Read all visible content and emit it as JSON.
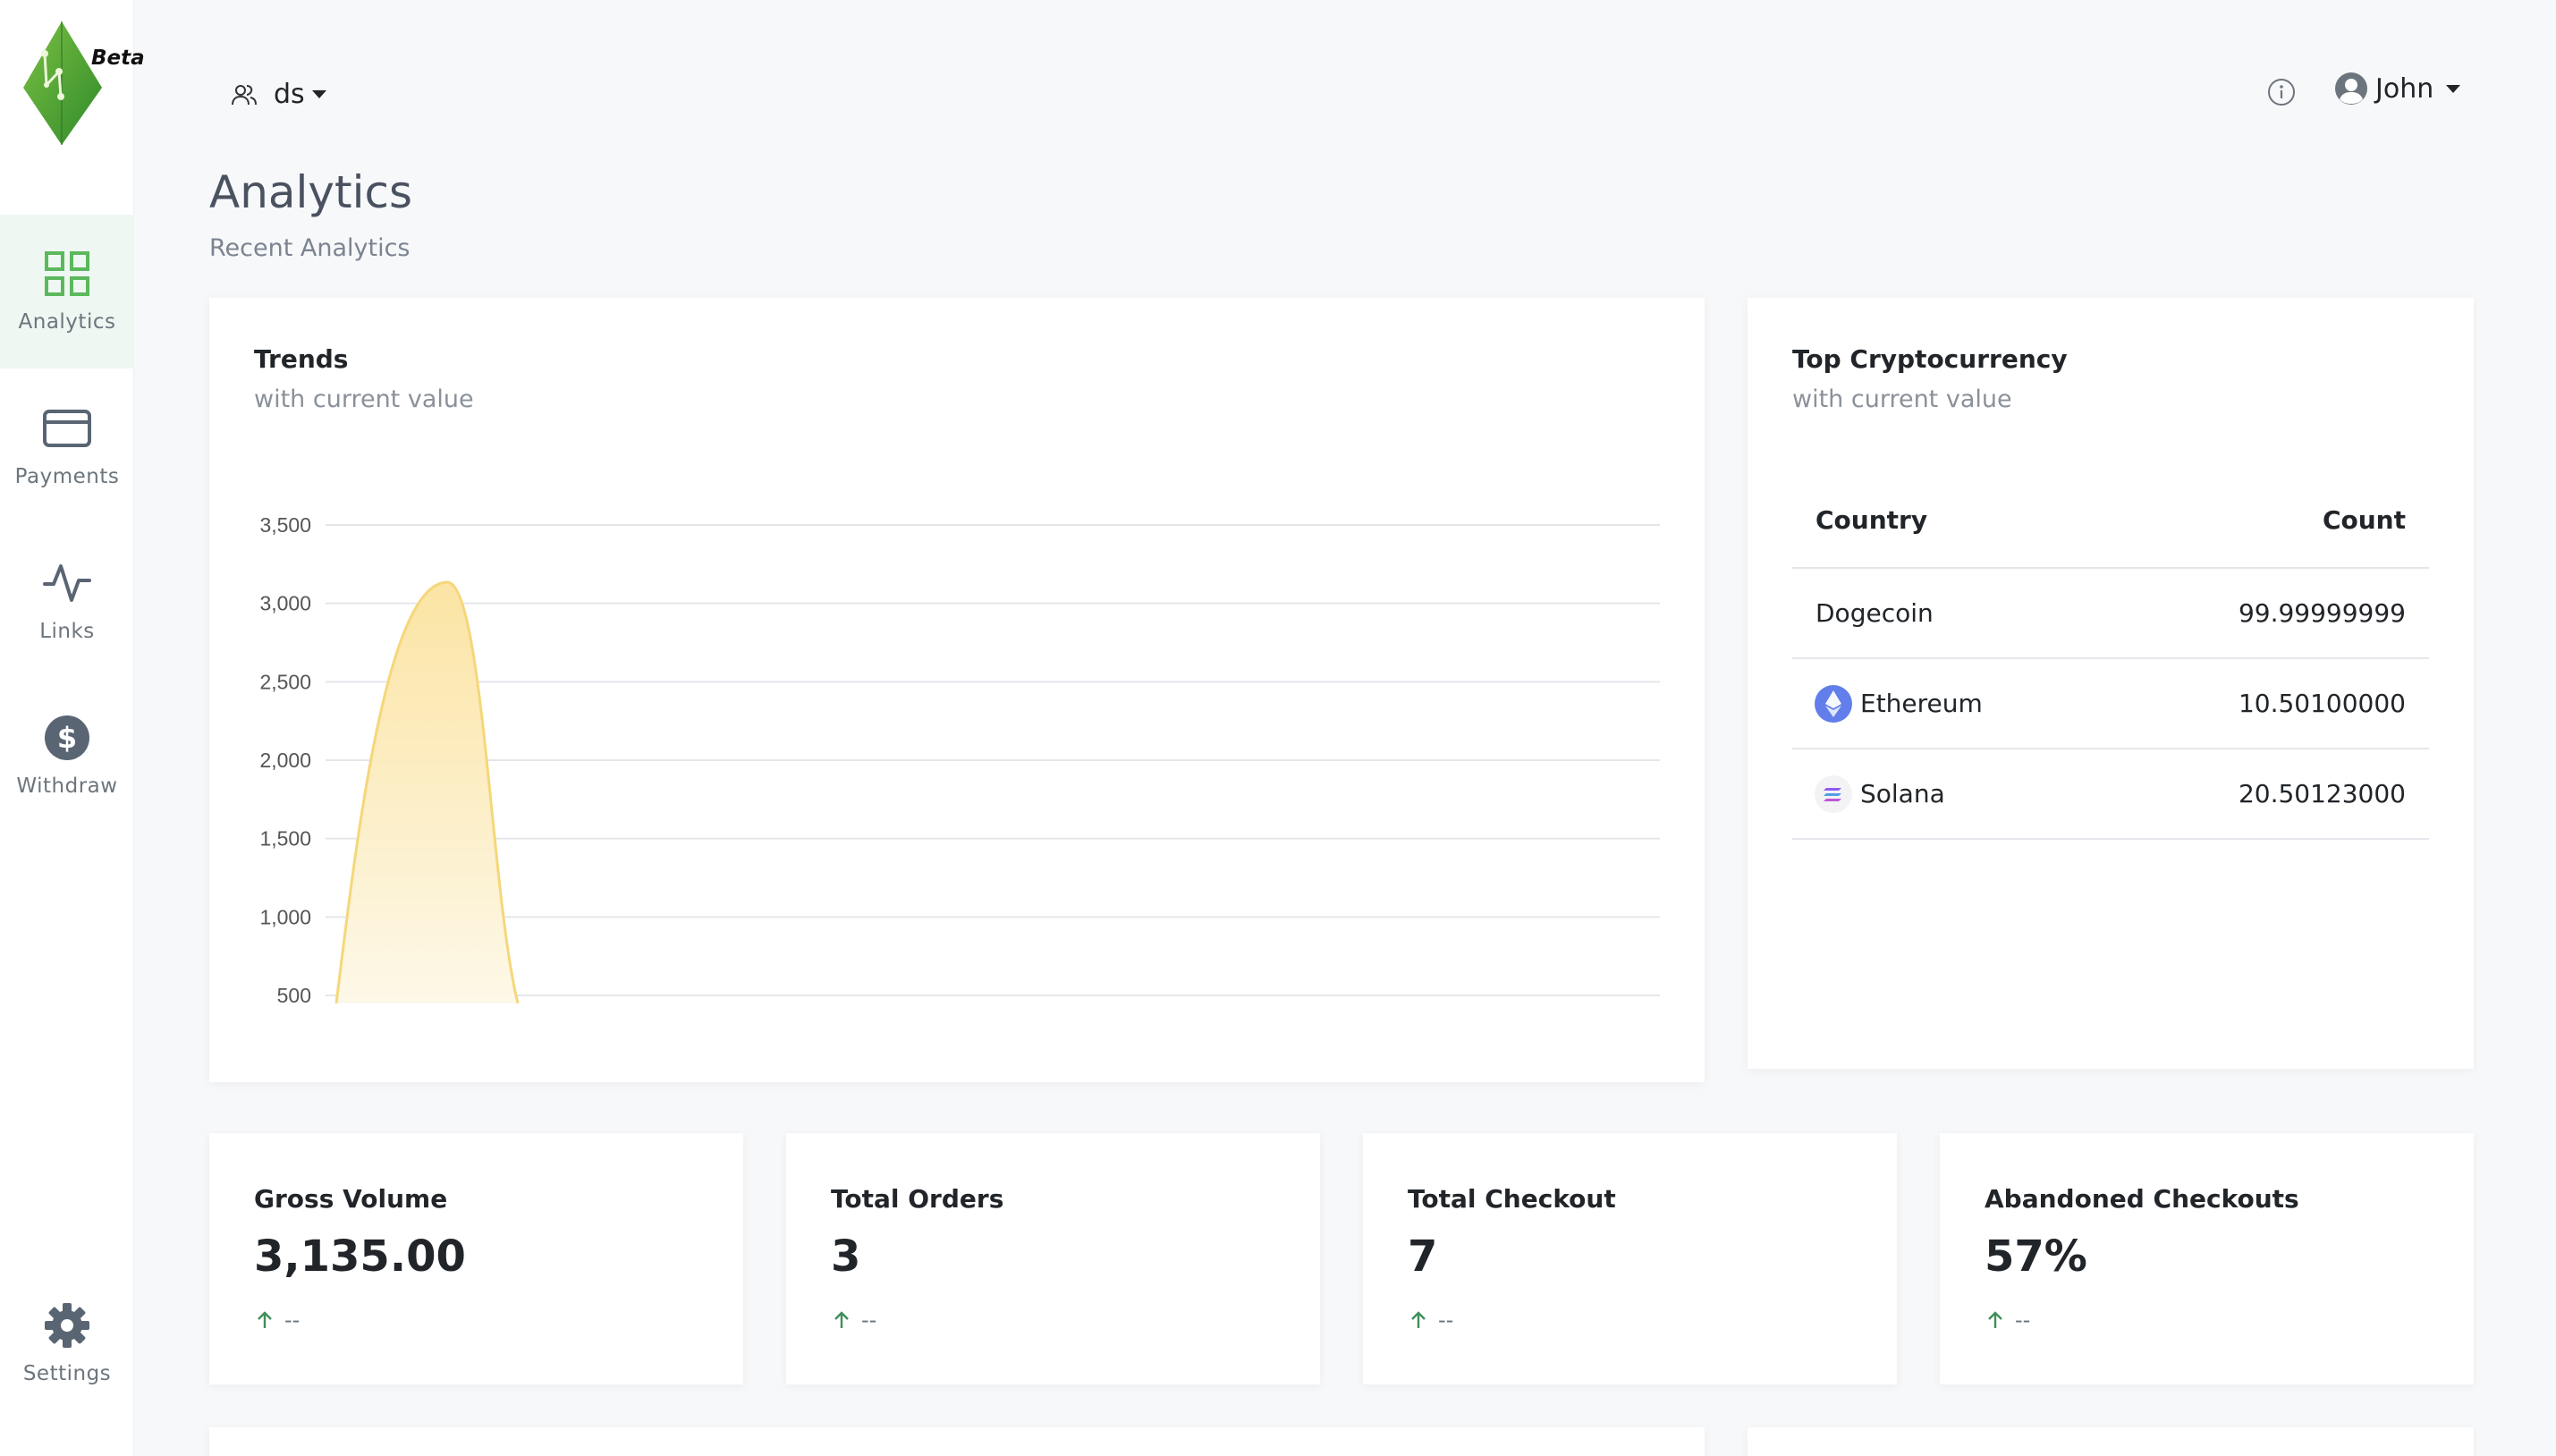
{
  "sidebar": {
    "logo_badge": "Beta",
    "items": [
      {
        "label": "Analytics",
        "icon": "grid-icon"
      },
      {
        "label": "Payments",
        "icon": "credit-card-icon"
      },
      {
        "label": "Links",
        "icon": "activity-icon"
      },
      {
        "label": "Withdraw",
        "icon": "dollar-coin-icon"
      }
    ],
    "settings": {
      "label": "Settings",
      "icon": "gear-icon"
    }
  },
  "topbar": {
    "org_name": "ds",
    "user_name": "John"
  },
  "header": {
    "title": "Analytics",
    "subtitle": "Recent Analytics"
  },
  "trends": {
    "title": "Trends",
    "subtitle": "with current value"
  },
  "chart_data": {
    "type": "area",
    "yticks": [
      "3,500",
      "3,000",
      "2,500",
      "2,000",
      "1,500",
      "1,000",
      "500"
    ],
    "ylim": [
      500,
      3500
    ],
    "x": [
      0,
      1,
      2
    ],
    "values": [
      450,
      3135,
      450
    ],
    "grid": true,
    "colors": {
      "stroke": "#f5d77a",
      "fill_top": "#fbe4a4",
      "fill_bottom": "#fdf8e8"
    }
  },
  "top_crypto": {
    "title": "Top Cryptocurrency",
    "subtitle": "with current value",
    "columns": [
      "Country",
      "Count"
    ],
    "rows": [
      {
        "name": "Dogecoin",
        "value": "99.99999999",
        "icon": ""
      },
      {
        "name": "Ethereum",
        "value": "10.50100000",
        "icon": "ethereum-icon"
      },
      {
        "name": "Solana",
        "value": "20.50123000",
        "icon": "solana-icon"
      }
    ]
  },
  "stats": [
    {
      "title": "Gross Volume",
      "value": "3,135.00",
      "delta": "--"
    },
    {
      "title": "Total Orders",
      "value": "3",
      "delta": "--"
    },
    {
      "title": "Total Checkout",
      "value": "7",
      "delta": "--"
    },
    {
      "title": "Abandoned Checkouts",
      "value": "57%",
      "delta": "--"
    }
  ],
  "colors": {
    "accent_green": "#5cb85c",
    "up_arrow": "#3f8f5a"
  }
}
